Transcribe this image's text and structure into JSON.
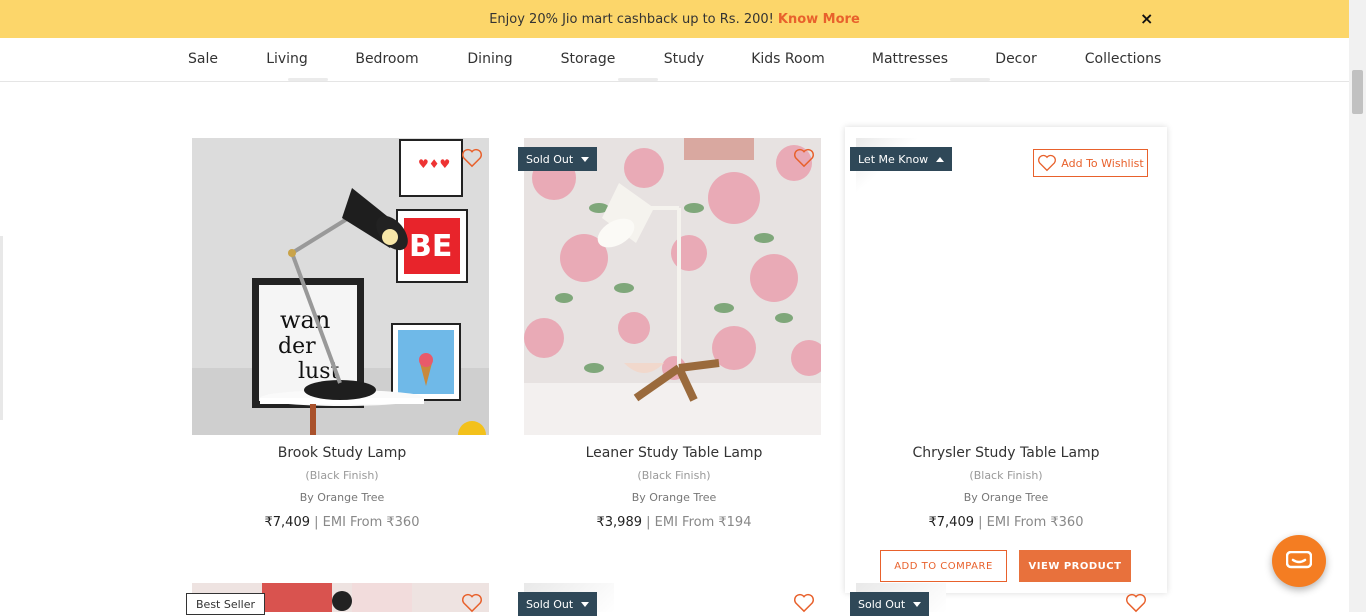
{
  "promo": {
    "text": "Enjoy 20% Jio mart cashback up to Rs. 200!",
    "link": "Know More",
    "close_icon": "×"
  },
  "nav": [
    "Sale",
    "Living",
    "Bedroom",
    "Dining",
    "Storage",
    "Study",
    "Kids Room",
    "Mattresses",
    "Decor",
    "Collections"
  ],
  "products": [
    {
      "title": "Brook Study Lamp",
      "finish": "(Black Finish)",
      "brand": "By Orange Tree",
      "price": "₹7,409",
      "emi": "| EMI From ₹360"
    },
    {
      "title": "Leaner Study Table Lamp",
      "finish": "(Black Finish)",
      "brand": "By Orange Tree",
      "price": "₹3,989",
      "emi": "| EMI From ₹194",
      "badge": "Sold Out"
    },
    {
      "title": "Chrysler Study Table Lamp",
      "finish": "(Black Finish)",
      "brand": "By Orange Tree",
      "price": "₹7,409",
      "emi": "| EMI From ₹360",
      "badge": "Let Me Know",
      "wishlist": "Add To Wishlist",
      "compare": "ADD TO COMPARE",
      "view": "VIEW PRODUCT"
    }
  ],
  "next_row": {
    "best_seller": "Best Seller",
    "badge_2": "Sold Out",
    "badge_3": "Sold Out"
  },
  "colors": {
    "accent": "#e8612c",
    "badge_bg": "#2f4858",
    "promo_bg": "#fcd66a"
  },
  "icons": [
    "close-icon",
    "heart-icon",
    "chevron-down-icon",
    "chevron-up-icon",
    "chat-icon"
  ]
}
